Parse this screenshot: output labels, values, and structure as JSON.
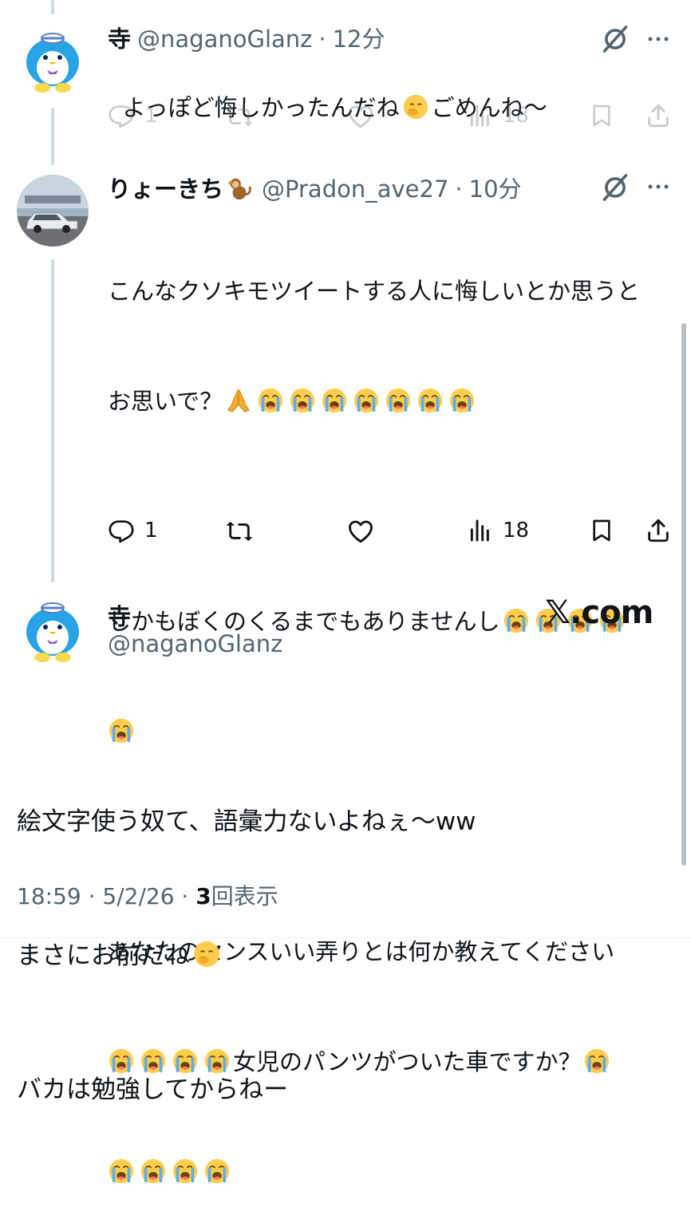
{
  "tweet1": {
    "name": "寺",
    "handle": "@naganoGlanz",
    "separator": "·",
    "time": "12分",
    "text_before_emoji": "よっぽど悔しかったんだね",
    "text_after_emoji": "ごめんね〜",
    "reply_count": "1",
    "view_count": "18"
  },
  "tweet2": {
    "name": "りょーきち",
    "handle": "@Pradon_ave27",
    "separator": "·",
    "time": "10分",
    "line1": "こんなクソキモツイートする人に悔しいとか思うと",
    "line2": "お思いで？",
    "line3": "しかもぼくのくるまでもありませんし",
    "line4": "あなたのセンスいい弄りとは何か教えてください",
    "line5_text": "女児のパンツがついた車ですか？",
    "reply_count": "1",
    "view_count": "18"
  },
  "main_tweet": {
    "name": "寺",
    "handle": "@naganoGlanz",
    "brand": "𝕏.com",
    "line1": "絵文字使う奴て、語彙力ないよねぇ〜ww",
    "line2": "まさにお前だね",
    "line3": "バカは勉強してからねー",
    "time": "18:59 · 5/2/26 · ",
    "views_num": "3",
    "views_label": "回表示"
  },
  "icons": {
    "reply": "reply-icon",
    "retweet": "retweet-icon",
    "like": "like-icon",
    "views": "views-icon",
    "bookmark": "bookmark-icon",
    "share": "share-icon",
    "grok": "grok-icon",
    "more": "more-icon"
  },
  "colors": {
    "text": "#0f1419",
    "muted": "#536471",
    "line": "#cfd9de",
    "avatar_bg": "#29a3e6"
  }
}
